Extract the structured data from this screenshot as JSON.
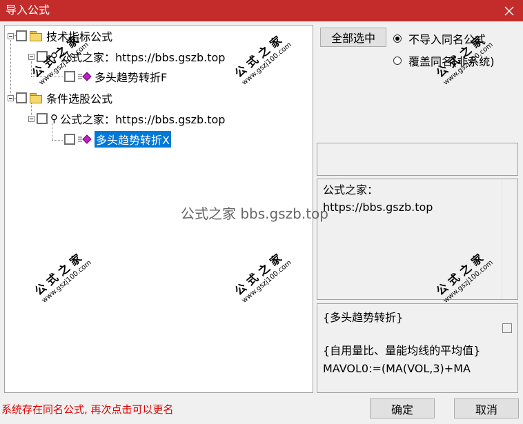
{
  "window": {
    "title": "导入公式",
    "close_glyph": "✕"
  },
  "tree": {
    "nodes": [
      {
        "id": "n1",
        "label": "技术指标公式",
        "icon": "folder-icon",
        "checked": false
      },
      {
        "id": "n2",
        "label": "公式之家：https://bbs.gszb.top",
        "icon": "key-icon",
        "checked": false
      },
      {
        "id": "n3",
        "label": "多头趋势转折F",
        "icon": "formula-icon",
        "checked": false
      },
      {
        "id": "n4",
        "label": "条件选股公式",
        "icon": "folder-icon",
        "checked": false
      },
      {
        "id": "n5",
        "label": "公式之家：https://bbs.gszb.top",
        "icon": "key-icon",
        "checked": false
      },
      {
        "id": "n6",
        "label": "多头趋势转折X",
        "icon": "formula-icon",
        "checked": false,
        "selected": true
      }
    ]
  },
  "buttons": {
    "select_all": "全部选中",
    "ok": "确定",
    "cancel": "取消"
  },
  "options": [
    {
      "label": "不导入同名公式",
      "selected": true
    },
    {
      "label": "覆盖同名(非系统)",
      "selected": false
    }
  ],
  "info_panel": {
    "line1": "公式之家：",
    "line2": "https://bbs.gszb.top"
  },
  "code_panel": {
    "line1": "{多头趋势转折}",
    "line2": "{自用量比、量能均线的平均值}",
    "line3": "MAVOL0:=(MA(VOL,3)+MA"
  },
  "status_text": "系统存在同名公式, 再次点击可以更名",
  "watermark": {
    "center": "公式之家 bbs.gszb.top",
    "stamp_title": "公式之家",
    "stamp_url": "www.gszj100.com"
  },
  "colors": {
    "titlebar": "#c42b2b",
    "selection": "#0078d7",
    "status": "#e00000"
  }
}
